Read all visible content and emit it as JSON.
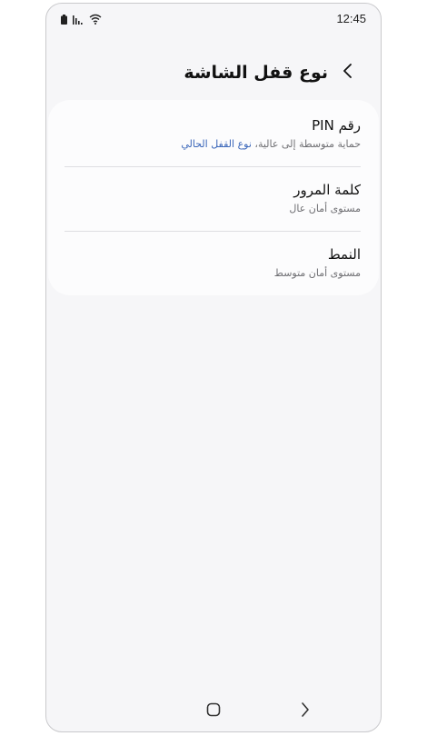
{
  "status_bar": {
    "time": "12:45",
    "icons": [
      "battery-icon",
      "signal-bars-icon",
      "wifi-icon"
    ]
  },
  "header": {
    "title": "نوع قفل الشاشة",
    "back_icon": "chevron-left-icon"
  },
  "options": [
    {
      "title": "رقم PIN",
      "subtitle": "حماية متوسطة إلى عالية، ",
      "current_label": "نوع القفل الحالي"
    },
    {
      "title": "كلمة المرور",
      "subtitle": "مستوى أمان عال"
    },
    {
      "title": "النمط",
      "subtitle": "مستوى أمان متوسط"
    }
  ],
  "nav_bar": {
    "icons": [
      "home-icon",
      "back-icon"
    ]
  }
}
